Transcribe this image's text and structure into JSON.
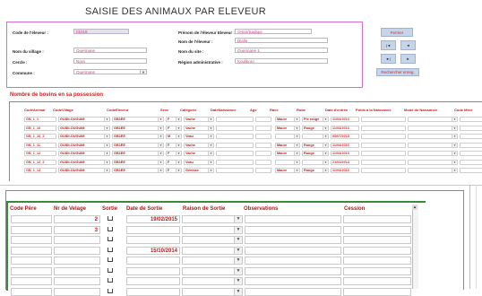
{
  "form": {
    "title": "SAISIE DES ANIMAUX PAR ELEVEUR"
  },
  "header": {
    "code_eleveur_label": "Code de l'éleveur :",
    "code_eleveur_value": "01018",
    "prenom_label": "Prénom de l'éleveur Eleveur :",
    "prenom_value": "Omar/Sadiqui",
    "nom_label": "Nom de l'éleveur :",
    "nom_value": "Diallo",
    "nom_village_label": "Nom du village :",
    "nom_village_value": "Ouerinane",
    "nom_site_label": "Nom du site :",
    "nom_site_value": "Ouerinane 1",
    "cercle_label": "Cercle :",
    "cercle_value": "Nara",
    "region_label": "Région administrative :",
    "region_value": "Koulikoro",
    "commune_label": "Commune :",
    "commune_value": "Ouerinane"
  },
  "nav": {
    "fermer_label": "Fermer",
    "first": "|◄",
    "prev": "◄",
    "next": "►|",
    "last": "►",
    "rechercher_label": "Rechercher enreg."
  },
  "bovins": {
    "section_title": "Nombre de bovins en sa possession",
    "columns": [
      "CodeAnimal",
      "CodeVillage",
      "CodeEleveur",
      "Sexe",
      "Catégorie",
      "DateNaissance",
      "Age",
      "Race",
      "Robe",
      "Date d'entrée",
      "Poids à la Naissance",
      "Mode de Naissance",
      "Code Mère"
    ],
    "rows": [
      {
        "code": "GB_1_1",
        "village": "GUIDI-OUGUIM",
        "eleveur": "GB1ÉE",
        "sexe": "F",
        "categorie": "Vache",
        "robe": "Pie rouge",
        "race": "Maure",
        "date": "11/04/2013"
      },
      {
        "code": "GB_1_10",
        "village": "GUIDI-OUGUIM",
        "eleveur": "GB1ÉE",
        "sexe": "F",
        "categorie": "Vache",
        "robe": "Rouge",
        "race": "Maure",
        "date": "11/04/2013"
      },
      {
        "code": "GB_1_10_2",
        "village": "GUIDI-OUGUIM",
        "eleveur": "GB1ÉE",
        "sexe": "M",
        "categorie": "Veau",
        "robe": "",
        "race": "",
        "date": "05/07/2013"
      },
      {
        "code": "GB_1_11",
        "village": "GUIDI-OUGUIM",
        "eleveur": "GB1ÉE",
        "sexe": "F",
        "categorie": "Vache",
        "robe": "Rouge",
        "race": "Maure",
        "date": "11/04/2013"
      },
      {
        "code": "GB_1_12",
        "village": "GUIDI-OUGUIM",
        "eleveur": "GB1ÉE",
        "sexe": "F",
        "categorie": "Vache",
        "robe": "Rouge",
        "race": "Maure",
        "date": "11/04/2013"
      },
      {
        "code": "GB_1_12_2",
        "village": "GUIDI-OUGUIM",
        "eleveur": "GB1ÉE",
        "sexe": "F",
        "categorie": "Veau",
        "robe": "",
        "race": "",
        "date": "21/04/2014"
      },
      {
        "code": "GB_1_13",
        "village": "GUIDI-OUGUIM",
        "eleveur": "GB1ÉE",
        "sexe": "F",
        "categorie": "Génisse",
        "robe": "Rouge",
        "race": "Maure",
        "date": "11/04/2013"
      }
    ]
  },
  "sorties": {
    "columns": [
      "Code Père",
      "Nr de Velage",
      "Sortie",
      "Date de Sortie",
      "Raison de Sortie",
      "Observations",
      "Cession"
    ],
    "rows": [
      {
        "nr_velage": "2",
        "date_sortie": "19/02/2015"
      },
      {
        "nr_velage": "3",
        "date_sortie": ""
      },
      {
        "nr_velage": "",
        "date_sortie": ""
      },
      {
        "nr_velage": "",
        "date_sortie": "15/10/2014"
      },
      {
        "nr_velage": "",
        "date_sortie": ""
      },
      {
        "nr_velage": "",
        "date_sortie": ""
      },
      {
        "nr_velage": "",
        "date_sortie": ""
      },
      {
        "nr_velage": "",
        "date_sortie": ""
      }
    ]
  }
}
